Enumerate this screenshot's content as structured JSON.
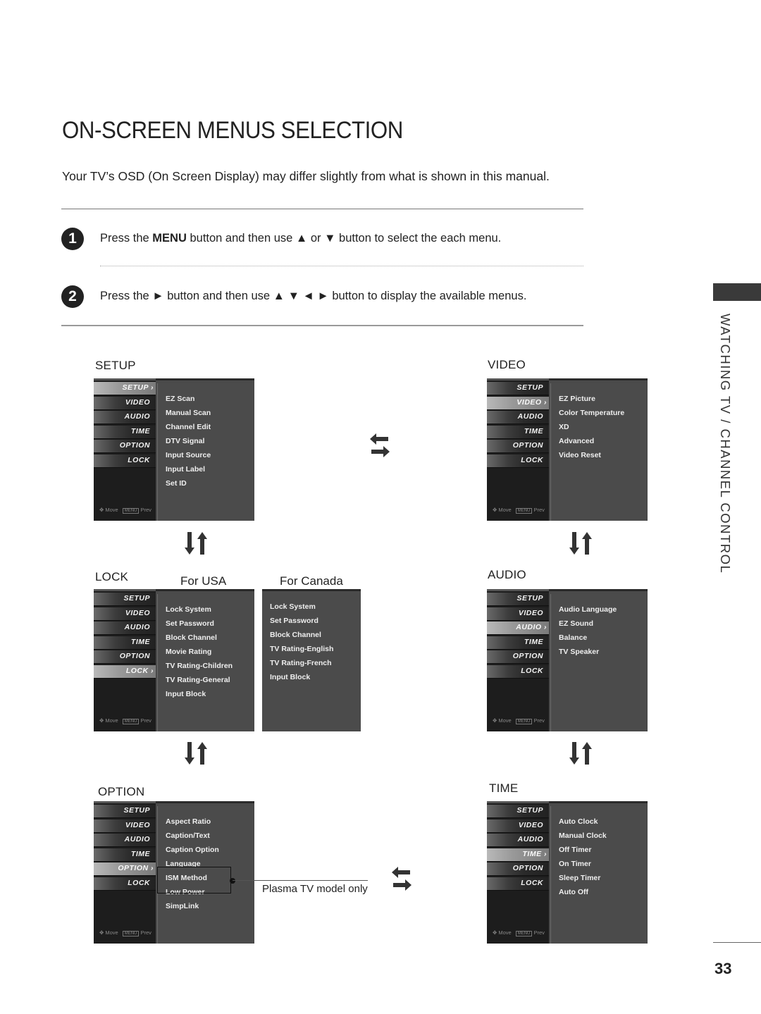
{
  "page": {
    "title": "ON-SCREEN MENUS SELECTION",
    "subtitle": "Your TV’s OSD (On Screen Display) may differ slightly from what is shown in this manual.",
    "side_section": "WATCHING TV / CHANNEL CONTROL",
    "page_number": "33"
  },
  "steps": [
    {
      "number": "1",
      "prefix": "Press the ",
      "bold": "MENU",
      "suffix": " button and then use ▲ or ▼ button to select the each menu."
    },
    {
      "number": "2",
      "prefix": "Press the ► button and then use ▲ ▼ ◄ ► button to display the available menus.",
      "bold": "",
      "suffix": ""
    }
  ],
  "osd_tabs": [
    "SETUP",
    "VIDEO",
    "AUDIO",
    "TIME",
    "OPTION",
    "LOCK"
  ],
  "osd_footer": {
    "move": "Move",
    "menu_key": "MENU",
    "prev": "Prev"
  },
  "menus": {
    "setup": {
      "label": "SETUP",
      "active_tab": "SETUP",
      "items": [
        "EZ Scan",
        "Manual Scan",
        "Channel Edit",
        "DTV Signal",
        "Input Source",
        "Input Label",
        "Set ID"
      ]
    },
    "video": {
      "label": "VIDEO",
      "active_tab": "VIDEO",
      "items": [
        "EZ Picture",
        "Color Temperature",
        "XD",
        "Advanced",
        "Video Reset"
      ]
    },
    "lock_usa": {
      "label": "LOCK",
      "region": "For USA",
      "active_tab": "LOCK",
      "items": [
        "Lock System",
        "Set Password",
        "Block Channel",
        "Movie Rating",
        "TV Rating-Children",
        "TV Rating-General",
        "Input Block"
      ]
    },
    "lock_canada": {
      "region": "For Canada",
      "items": [
        "Lock System",
        "Set Password",
        "Block Channel",
        "TV Rating-English",
        "TV Rating-French",
        "Input Block"
      ]
    },
    "audio": {
      "label": "AUDIO",
      "active_tab": "AUDIO",
      "items": [
        "Audio Language",
        "EZ Sound",
        "Balance",
        "TV Speaker"
      ]
    },
    "option": {
      "label": "OPTION",
      "active_tab": "OPTION",
      "items": [
        "Aspect Ratio",
        "Caption/Text",
        "Caption Option",
        "Language",
        "ISM Method",
        "Low Power",
        "SimpLink"
      ],
      "note": "Plasma TV model only"
    },
    "time": {
      "label": "TIME",
      "active_tab": "TIME",
      "items": [
        "Auto Clock",
        "Manual Clock",
        "Off Timer",
        "On Timer",
        "Sleep Timer",
        "Auto Off"
      ]
    }
  },
  "icons": {
    "step_bullet": "numbered-circle",
    "horizontal_nav": "left-right-arrows-icon",
    "vertical_nav": "up-down-arrows-icon",
    "osd_move": "dpad-icon"
  }
}
